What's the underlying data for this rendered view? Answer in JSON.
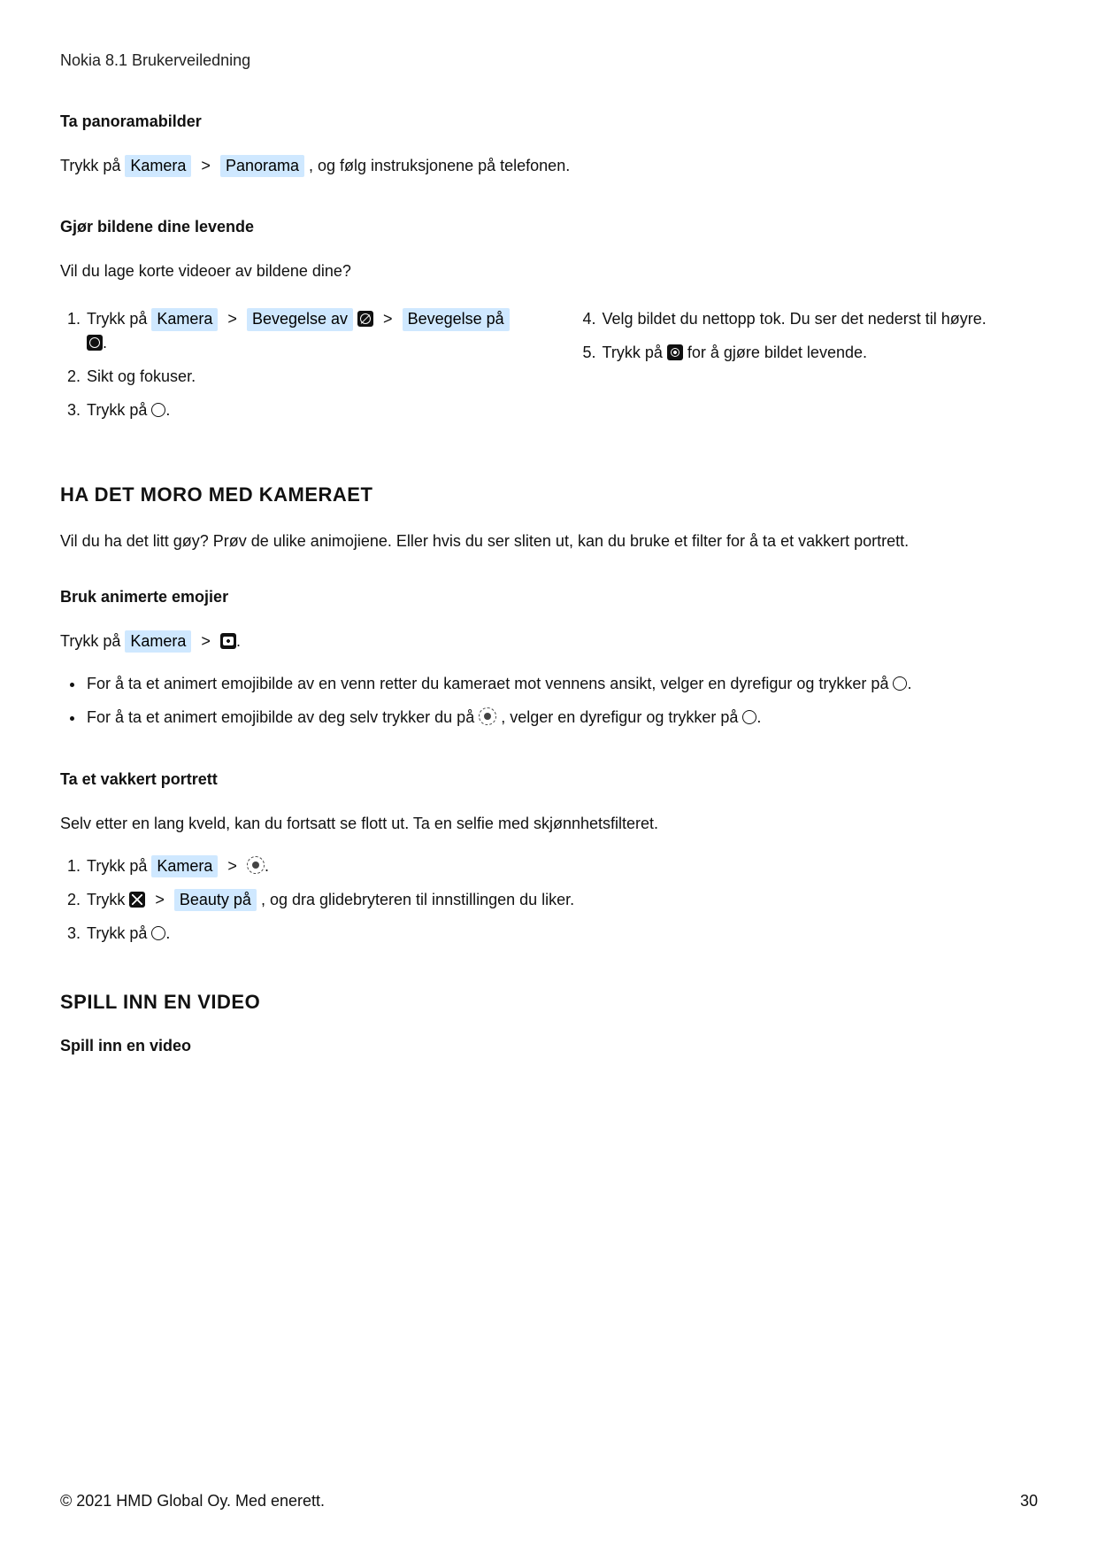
{
  "doc_title": "Nokia 8.1 Brukerveiledning",
  "sec_panorama": {
    "heading": "Ta panoramabilder",
    "p_pre": "Trykk på ",
    "chip1": "Kamera",
    "chip2": "Panorama",
    "p_post": ", og følg instruksjonene på telefonen."
  },
  "sec_live": {
    "heading": "Gjør bildene dine levende",
    "intro": "Vil du lage korte videoer av bildene dine?",
    "left": {
      "s1_pre": "Trykk på ",
      "s1_c1": "Kamera",
      "s1_c2": "Bevegelse av",
      "s1_c3": "Bevegelse på",
      "s2": "Sikt og fokuser.",
      "s3_pre": "Trykk på "
    },
    "right": {
      "s4": "Velg bildet du nettopp tok. Du ser det nederst til høyre.",
      "s5_pre": "Trykk på ",
      "s5_post": " for å gjøre bildet levende."
    }
  },
  "sec_fun": {
    "heading": "HA DET MORO MED KAMERAET",
    "intro": "Vil du ha det litt gøy? Prøv de ulike animojiene. Eller hvis du ser sliten ut, kan du bruke et filter for å ta et vakkert portrett."
  },
  "sec_emoji": {
    "heading": "Bruk animerte emojier",
    "p_pre": "Trykk på ",
    "p_chip": "Kamera",
    "b1a": "For å ta et animert emojibilde av en venn retter du kameraet mot vennens ansikt, velger en dyrefigur og trykker på ",
    "b2a": "For å ta et animert emojibilde av deg selv trykker du på ",
    "b2b": ", velger en dyrefigur og trykker på "
  },
  "sec_portrait": {
    "heading": "Ta et vakkert portrett",
    "intro": "Selv etter en lang kveld, kan du fortsatt se flott ut. Ta en selfie med skjønnhetsfilteret.",
    "s1_pre": "Trykk på ",
    "s1_chip": "Kamera",
    "s2_pre": "Trykk ",
    "s2_chip": "Beauty på",
    "s2_post": ", og dra glidebryteren til innstillingen du liker.",
    "s3_pre": "Trykk på "
  },
  "sec_video": {
    "heading": "SPILL INN EN VIDEO",
    "sub": "Spill inn en video"
  },
  "footer_left": "© 2021 HMD Global Oy. Med enerett.",
  "footer_right": "30"
}
